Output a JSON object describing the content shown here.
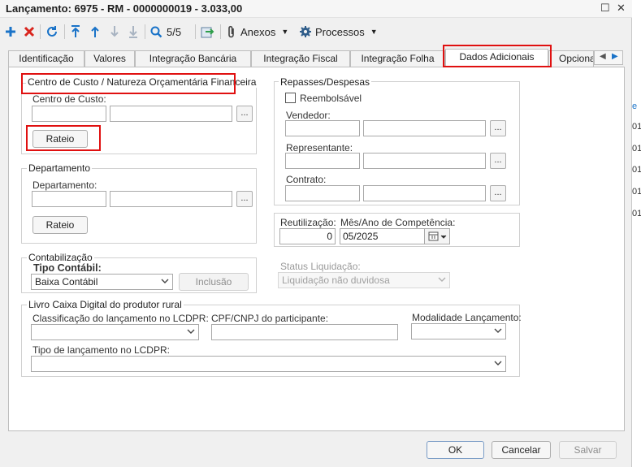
{
  "window": {
    "title": "Lançamento: 6975 - RM - 0000000019 - 3.033,00"
  },
  "toolbar": {
    "record_position": "5/5",
    "attachments_label": "Anexos",
    "processes_label": "Processos"
  },
  "tabs": {
    "identificacao": "Identificação",
    "valores": "Valores",
    "integracao_bancaria": "Integração Bancária",
    "integracao_fiscal": "Integração Fiscal",
    "integracao_folha": "Integração Folha",
    "dados_adicionais": "Dados Adicionais",
    "opcional": "Opciona"
  },
  "centro_custo": {
    "group_title": "Centro de Custo / Natureza Orçamentária Financeira",
    "field_label": "Centro de Custo:",
    "rateio_label": "Rateio"
  },
  "departamento": {
    "group_title": "Departamento",
    "field_label": "Departamento:",
    "rateio_label": "Rateio"
  },
  "repasses": {
    "group_title": "Repasses/Despesas",
    "reembolsavel_label": "Reembolsável",
    "vendedor_label": "Vendedor:",
    "representante_label": "Representante:",
    "contrato_label": "Contrato:"
  },
  "reutilizacao": {
    "label": "Reutilização:",
    "value": "0"
  },
  "competencia": {
    "label": "Mês/Ano de Competência:",
    "value": "05/2025"
  },
  "contabilizacao": {
    "group_title": "Contabilização",
    "tipo_label": "Tipo Contábil:",
    "tipo_value": "Baixa Contábil",
    "inclusao_label": "Inclusão"
  },
  "status": {
    "label": "Status Liquidação:",
    "value": "Liquidação não duvidosa"
  },
  "lcdpr": {
    "group_title": "Livro Caixa Digital do produtor rural",
    "classificacao_label": "Classificação do lançamento no LCDPR:",
    "cpf_label": "CPF/CNPJ do participante:",
    "modalidade_label": "Modalidade Lançamento:",
    "tipo_label": "Tipo de lançamento no LCDPR:"
  },
  "buttons": {
    "ok": "OK",
    "cancel": "Cancelar",
    "save": "Salvar"
  },
  "background": {
    "column_header": "e",
    "row_values": [
      "01/",
      "01/",
      "01/",
      "01/",
      "01/"
    ]
  },
  "colors": {
    "accent": "#1a73c8",
    "highlight": "#e01010",
    "delete": "#d9251d"
  }
}
